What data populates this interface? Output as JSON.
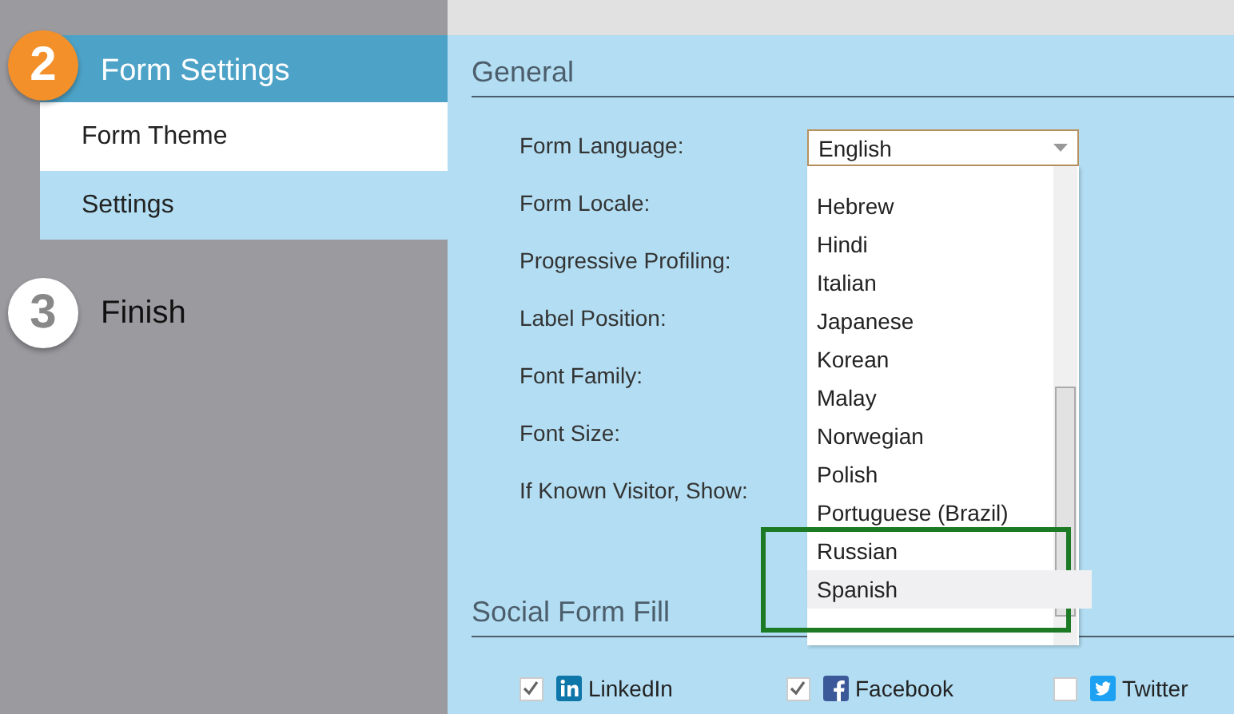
{
  "steps": [
    {
      "number": "2",
      "label": "Form Settings",
      "active": true,
      "children": [
        {
          "label": "Form Theme",
          "selected": false
        },
        {
          "label": "Settings",
          "selected": true
        }
      ]
    },
    {
      "number": "3",
      "label": "Finish",
      "active": false
    }
  ],
  "general": {
    "heading": "General",
    "fields": [
      {
        "label": "Form Language:"
      },
      {
        "label": "Form Locale:"
      },
      {
        "label": "Progressive Profiling:"
      },
      {
        "label": "Label Position:"
      },
      {
        "label": "Font Family:"
      },
      {
        "label": "Font Size:"
      },
      {
        "label": "If Known Visitor, Show:"
      }
    ],
    "language_select": {
      "value": "English",
      "options": [
        {
          "label": "Hebrew",
          "selected": false
        },
        {
          "label": "Hindi",
          "selected": false
        },
        {
          "label": "Italian",
          "selected": false
        },
        {
          "label": "Japanese",
          "selected": false
        },
        {
          "label": "Korean",
          "selected": false
        },
        {
          "label": "Malay",
          "selected": false
        },
        {
          "label": "Norwegian",
          "selected": false
        },
        {
          "label": "Polish",
          "selected": false
        },
        {
          "label": "Portuguese (Brazil)",
          "selected": false
        },
        {
          "label": "Russian",
          "selected": false,
          "framed": true
        },
        {
          "label": "Spanish",
          "selected": true,
          "framed": true
        }
      ]
    }
  },
  "social": {
    "heading": "Social Form Fill",
    "options": [
      {
        "label": "LinkedIn",
        "kind": "linkedin",
        "checked": true
      },
      {
        "label": "Facebook",
        "kind": "facebook",
        "checked": true
      },
      {
        "label": "Twitter",
        "kind": "twitter",
        "checked": false
      }
    ]
  }
}
